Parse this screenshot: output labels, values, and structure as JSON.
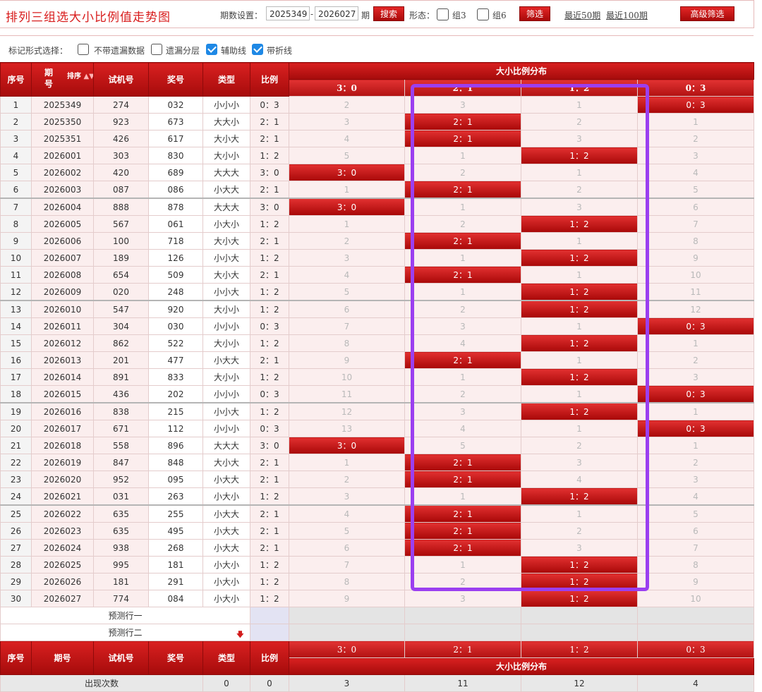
{
  "header": {
    "title": "排列三组选大小比例值走势图",
    "period_label": "期数设置：",
    "period_start": "2025349",
    "period_sep": "-",
    "period_end": "2026027",
    "period_unit": "期",
    "search_btn": "搜索",
    "form_label": "形态：",
    "group3_label": "组3",
    "group6_label": "组6",
    "filter_btn": "筛选",
    "recent50": "最近50期",
    "recent100": "最近100期",
    "advanced_btn": "高级筛选"
  },
  "options": {
    "label": "标记形式选择：",
    "no_miss": "不带遗漏数据",
    "miss_layer": "遗漏分层",
    "aux_line": "辅助线",
    "fold_line": "带折线",
    "checked": [
      false,
      false,
      true,
      true
    ]
  },
  "table": {
    "headers": {
      "seq": "序号",
      "period_top": "期",
      "period_bottom": "号",
      "sort": "排序",
      "test": "试机号",
      "award": "奖号",
      "type": "类型",
      "ratio": "比例",
      "dist": "大小比例分布",
      "dist_cols": [
        "3：0",
        "2：1",
        "1：2",
        "0：3"
      ],
      "period_footer": "期号"
    },
    "rows": [
      {
        "seq": "1",
        "period": "2025349",
        "test": "274",
        "award": "032",
        "type": "小小小",
        "ratio": "0：3",
        "cells": [
          "2",
          "3",
          "1",
          "0：3"
        ],
        "hit": 3
      },
      {
        "seq": "2",
        "period": "2025350",
        "test": "923",
        "award": "673",
        "type": "大大小",
        "ratio": "2：1",
        "cells": [
          "3",
          "2：1",
          "2",
          "1"
        ],
        "hit": 1
      },
      {
        "seq": "3",
        "period": "2025351",
        "test": "426",
        "award": "617",
        "type": "大小大",
        "ratio": "2：1",
        "cells": [
          "4",
          "2：1",
          "3",
          "2"
        ],
        "hit": 1
      },
      {
        "seq": "4",
        "period": "2026001",
        "test": "303",
        "award": "830",
        "type": "大小小",
        "ratio": "1：2",
        "cells": [
          "5",
          "1",
          "1：2",
          "3"
        ],
        "hit": 2
      },
      {
        "seq": "5",
        "period": "2026002",
        "test": "420",
        "award": "689",
        "type": "大大大",
        "ratio": "3：0",
        "cells": [
          "3：0",
          "2",
          "1",
          "4"
        ],
        "hit": 0
      },
      {
        "seq": "6",
        "period": "2026003",
        "test": "087",
        "award": "086",
        "type": "小大大",
        "ratio": "2：1",
        "cells": [
          "1",
          "2：1",
          "2",
          "5"
        ],
        "hit": 1
      },
      {
        "seq": "7",
        "period": "2026004",
        "test": "888",
        "award": "878",
        "type": "大大大",
        "ratio": "3：0",
        "cells": [
          "3：0",
          "1",
          "3",
          "6"
        ],
        "hit": 0
      },
      {
        "seq": "8",
        "period": "2026005",
        "test": "567",
        "award": "061",
        "type": "小大小",
        "ratio": "1：2",
        "cells": [
          "1",
          "2",
          "1：2",
          "7"
        ],
        "hit": 2
      },
      {
        "seq": "9",
        "period": "2026006",
        "test": "100",
        "award": "718",
        "type": "大小大",
        "ratio": "2：1",
        "cells": [
          "2",
          "2：1",
          "1",
          "8"
        ],
        "hit": 1
      },
      {
        "seq": "10",
        "period": "2026007",
        "test": "189",
        "award": "126",
        "type": "小小大",
        "ratio": "1：2",
        "cells": [
          "3",
          "1",
          "1：2",
          "9"
        ],
        "hit": 2
      },
      {
        "seq": "11",
        "period": "2026008",
        "test": "654",
        "award": "509",
        "type": "大小大",
        "ratio": "2：1",
        "cells": [
          "4",
          "2：1",
          "1",
          "10"
        ],
        "hit": 1
      },
      {
        "seq": "12",
        "period": "2026009",
        "test": "020",
        "award": "248",
        "type": "小小大",
        "ratio": "1：2",
        "cells": [
          "5",
          "1",
          "1：2",
          "11"
        ],
        "hit": 2
      },
      {
        "seq": "13",
        "period": "2026010",
        "test": "547",
        "award": "920",
        "type": "大小小",
        "ratio": "1：2",
        "cells": [
          "6",
          "2",
          "1：2",
          "12"
        ],
        "hit": 2
      },
      {
        "seq": "14",
        "period": "2026011",
        "test": "304",
        "award": "030",
        "type": "小小小",
        "ratio": "0：3",
        "cells": [
          "7",
          "3",
          "1",
          "0：3"
        ],
        "hit": 3
      },
      {
        "seq": "15",
        "period": "2026012",
        "test": "862",
        "award": "522",
        "type": "大小小",
        "ratio": "1：2",
        "cells": [
          "8",
          "4",
          "1：2",
          "1"
        ],
        "hit": 2
      },
      {
        "seq": "16",
        "period": "2026013",
        "test": "201",
        "award": "477",
        "type": "小大大",
        "ratio": "2：1",
        "cells": [
          "9",
          "2：1",
          "1",
          "2"
        ],
        "hit": 1
      },
      {
        "seq": "17",
        "period": "2026014",
        "test": "891",
        "award": "833",
        "type": "大小小",
        "ratio": "1：2",
        "cells": [
          "10",
          "1",
          "1：2",
          "3"
        ],
        "hit": 2
      },
      {
        "seq": "18",
        "period": "2026015",
        "test": "436",
        "award": "202",
        "type": "小小小",
        "ratio": "0：3",
        "cells": [
          "11",
          "2",
          "1",
          "0：3"
        ],
        "hit": 3
      },
      {
        "seq": "19",
        "period": "2026016",
        "test": "838",
        "award": "215",
        "type": "小小大",
        "ratio": "1：2",
        "cells": [
          "12",
          "3",
          "1：2",
          "1"
        ],
        "hit": 2
      },
      {
        "seq": "20",
        "period": "2026017",
        "test": "671",
        "award": "112",
        "type": "小小小",
        "ratio": "0：3",
        "cells": [
          "13",
          "4",
          "1",
          "0：3"
        ],
        "hit": 3
      },
      {
        "seq": "21",
        "period": "2026018",
        "test": "558",
        "award": "896",
        "type": "大大大",
        "ratio": "3：0",
        "cells": [
          "3：0",
          "5",
          "2",
          "1"
        ],
        "hit": 0
      },
      {
        "seq": "22",
        "period": "2026019",
        "test": "847",
        "award": "848",
        "type": "大小大",
        "ratio": "2：1",
        "cells": [
          "1",
          "2：1",
          "3",
          "2"
        ],
        "hit": 1
      },
      {
        "seq": "23",
        "period": "2026020",
        "test": "952",
        "award": "095",
        "type": "小大大",
        "ratio": "2：1",
        "cells": [
          "2",
          "2：1",
          "4",
          "3"
        ],
        "hit": 1
      },
      {
        "seq": "24",
        "period": "2026021",
        "test": "031",
        "award": "263",
        "type": "小大小",
        "ratio": "1：2",
        "cells": [
          "3",
          "1",
          "1：2",
          "4"
        ],
        "hit": 2
      },
      {
        "seq": "25",
        "period": "2026022",
        "test": "635",
        "award": "255",
        "type": "小大大",
        "ratio": "2：1",
        "cells": [
          "4",
          "2：1",
          "1",
          "5"
        ],
        "hit": 1
      },
      {
        "seq": "26",
        "period": "2026023",
        "test": "635",
        "award": "495",
        "type": "小大大",
        "ratio": "2：1",
        "cells": [
          "5",
          "2：1",
          "2",
          "6"
        ],
        "hit": 1
      },
      {
        "seq": "27",
        "period": "2026024",
        "test": "938",
        "award": "268",
        "type": "小大大",
        "ratio": "2：1",
        "cells": [
          "6",
          "2：1",
          "3",
          "7"
        ],
        "hit": 1
      },
      {
        "seq": "28",
        "period": "2026025",
        "test": "995",
        "award": "181",
        "type": "小大小",
        "ratio": "1：2",
        "cells": [
          "7",
          "1",
          "1：2",
          "8"
        ],
        "hit": 2
      },
      {
        "seq": "29",
        "period": "2026026",
        "test": "181",
        "award": "291",
        "type": "小大小",
        "ratio": "1：2",
        "cells": [
          "8",
          "2",
          "1：2",
          "9"
        ],
        "hit": 2
      },
      {
        "seq": "30",
        "period": "2026027",
        "test": "774",
        "award": "084",
        "type": "小大小",
        "ratio": "1：2",
        "cells": [
          "9",
          "3",
          "1：2",
          "10"
        ],
        "hit": 2
      }
    ],
    "predict1": "预测行一",
    "predict2": "预测行二",
    "count_label": "出现次数",
    "count_type": "0",
    "count_ratio": "0",
    "counts": [
      "3",
      "11",
      "12",
      "4"
    ]
  },
  "colors": {
    "accent_red": "#c41414",
    "highlight_box": "#9b3ff0",
    "checkbox_blue": "#1e88e5"
  }
}
